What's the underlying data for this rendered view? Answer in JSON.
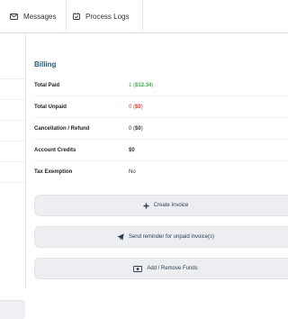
{
  "tabs": [
    {
      "label": "Messages",
      "icon": "envelope-icon"
    },
    {
      "label": "Process Logs",
      "icon": "calendar-check-icon"
    }
  ],
  "billing": {
    "title": "Billing",
    "rows": [
      {
        "label": "Total Paid",
        "value_pre": "1 (",
        "value_amount": "$12.34",
        "value_post": ")",
        "color": "#3aa84d"
      },
      {
        "label": "Total Unpaid",
        "value_pre": "0 (",
        "value_amount": "$0",
        "value_post": ")",
        "color": "#d9342b"
      },
      {
        "label": "Cancellation / Refund",
        "value_pre": "0 (",
        "value_amount": "$0",
        "value_post": ")",
        "color": "#333333"
      },
      {
        "label": "Account Credits",
        "value_pre": "",
        "value_amount": "$0",
        "value_post": "",
        "color": "#222222"
      },
      {
        "label": "Tax Exemption",
        "value_pre": "No",
        "value_amount": "",
        "value_post": "",
        "color": "#333333"
      }
    ]
  },
  "actions": {
    "create_invoice": "Create Invoice",
    "send_reminder": "Send reminder for unpaid invoice(s)",
    "add_remove_funds": "Add / Remove Funds"
  },
  "colors": {
    "accent": "#1f5d78",
    "paid": "#3aa84d",
    "unpaid": "#d9342b",
    "button_bg": "#eceef1"
  }
}
